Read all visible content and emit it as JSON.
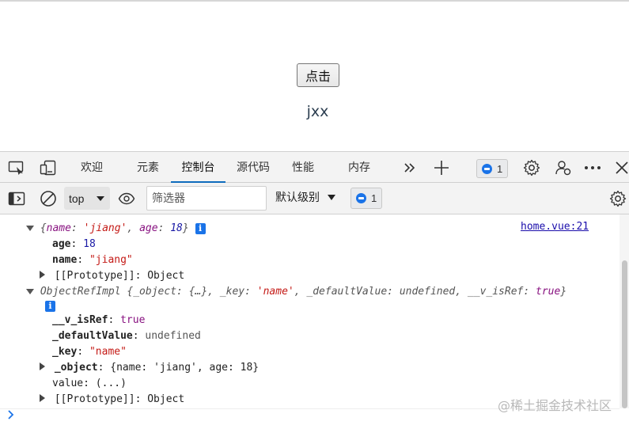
{
  "page": {
    "button_label": "点击",
    "text": "jxx"
  },
  "devtools": {
    "tabs": [
      {
        "label": "欢迎"
      },
      {
        "label": "元素"
      },
      {
        "label": "控制台"
      },
      {
        "label": "源代码"
      },
      {
        "label": "性能"
      },
      {
        "label": "内存"
      }
    ],
    "issue_count": "1",
    "accent_color": "#0f6cbd"
  },
  "console_toolbar": {
    "context": "top",
    "filter_placeholder": "筛选器",
    "levels_label": "默认级别",
    "issue_count": "1"
  },
  "console": {
    "source_link": "home.vue:21",
    "obj1": {
      "open_brace": "{",
      "k1": "name",
      "v1": "'jiang'",
      "k2": "age",
      "v2": "18",
      "close_brace": "}",
      "age_key": "age",
      "age_val": "18",
      "name_key": "name",
      "name_val": "\"jiang\"",
      "proto_key": "[[Prototype]]",
      "proto_val": "Object"
    },
    "obj2": {
      "class_name": "ObjectRefImpl",
      "preview_1": "{_object: {…}, _key: ",
      "preview_key_val": "'name'",
      "preview_2": ", _defaultValue: ",
      "preview_undef": "undefined",
      "preview_3": ", __v_isRef: ",
      "preview_true": "true",
      "preview_4": "}",
      "isref_key": "__v_isRef",
      "isref_val": "true",
      "default_key": "_defaultValue",
      "default_val": "undefined",
      "key_key": "_key",
      "key_val": "\"name\"",
      "object_key": "_object",
      "object_val": "{name: 'jiang', age: 18}",
      "value_key": "value",
      "value_val": "(...)",
      "proto_key": "[[Prototype]]",
      "proto_val": "Object"
    },
    "info_glyph": "i"
  },
  "watermark": "@稀土掘金技术社区"
}
